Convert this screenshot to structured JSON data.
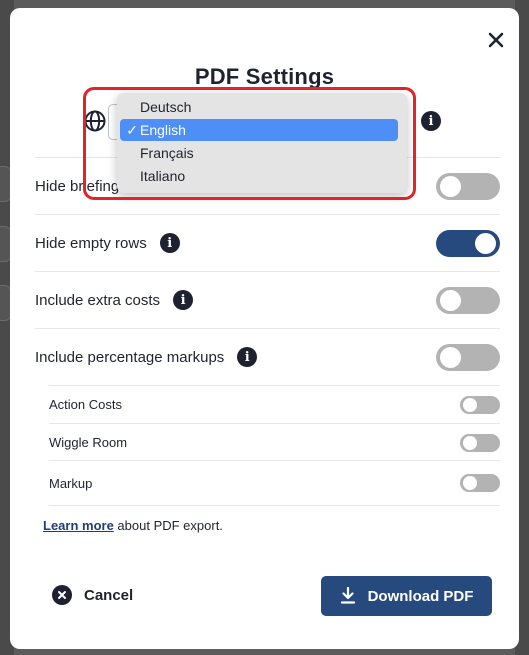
{
  "dialog": {
    "title": "PDF Settings",
    "language": {
      "selected": "English",
      "options": [
        "Deutsch",
        "English",
        "Français",
        "Italiano"
      ],
      "check_mark": "✓"
    },
    "settings": [
      {
        "label": "Hide briefing",
        "info": false,
        "on": false
      },
      {
        "label": "Hide empty rows",
        "info": true,
        "on": true
      },
      {
        "label": "Include extra costs",
        "info": true,
        "on": false
      },
      {
        "label": "Include percentage markups",
        "info": true,
        "on": false
      }
    ],
    "sub_settings": [
      {
        "label": "Action Costs",
        "on": false
      },
      {
        "label": "Wiggle Room",
        "on": false
      },
      {
        "label": "Markup",
        "on": false
      }
    ],
    "footer": {
      "learn_more_link": "Learn more",
      "learn_more_text": " about PDF export."
    },
    "buttons": {
      "cancel": "Cancel",
      "download": "Download PDF"
    },
    "icons": {
      "close": "close-icon",
      "globe": "globe-icon",
      "info": "info-icon",
      "cancel": "x-circle-icon",
      "download": "download-icon"
    },
    "colors": {
      "accent": "#274a7e",
      "selected_option": "#4d8ff7",
      "highlight": "#e0242a",
      "toggle_off": "#b3b3b3"
    }
  }
}
